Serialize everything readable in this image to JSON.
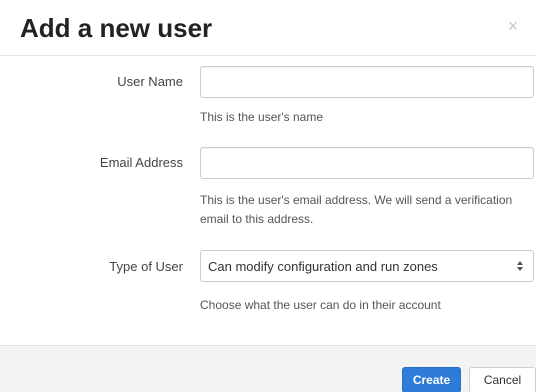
{
  "modal": {
    "title": "Add a new user",
    "close_label": "×"
  },
  "form": {
    "user_name": {
      "label": "User Name",
      "value": "",
      "help": "This is the user's name"
    },
    "email": {
      "label": "Email Address",
      "value": "",
      "help": "This is the user's email address. We will send a verification email to this address."
    },
    "user_type": {
      "label": "Type of User",
      "selected": "Can modify configuration and run zones",
      "help": "Choose what the user can do in their account"
    }
  },
  "footer": {
    "create_label": "Create",
    "cancel_label": "Cancel"
  },
  "colors": {
    "primary": "#2f7bd8",
    "footer_bg": "#f3f3f3",
    "border": "#cccccc"
  },
  "icons": {
    "close": "close-icon",
    "select": "select-arrows-icon"
  }
}
